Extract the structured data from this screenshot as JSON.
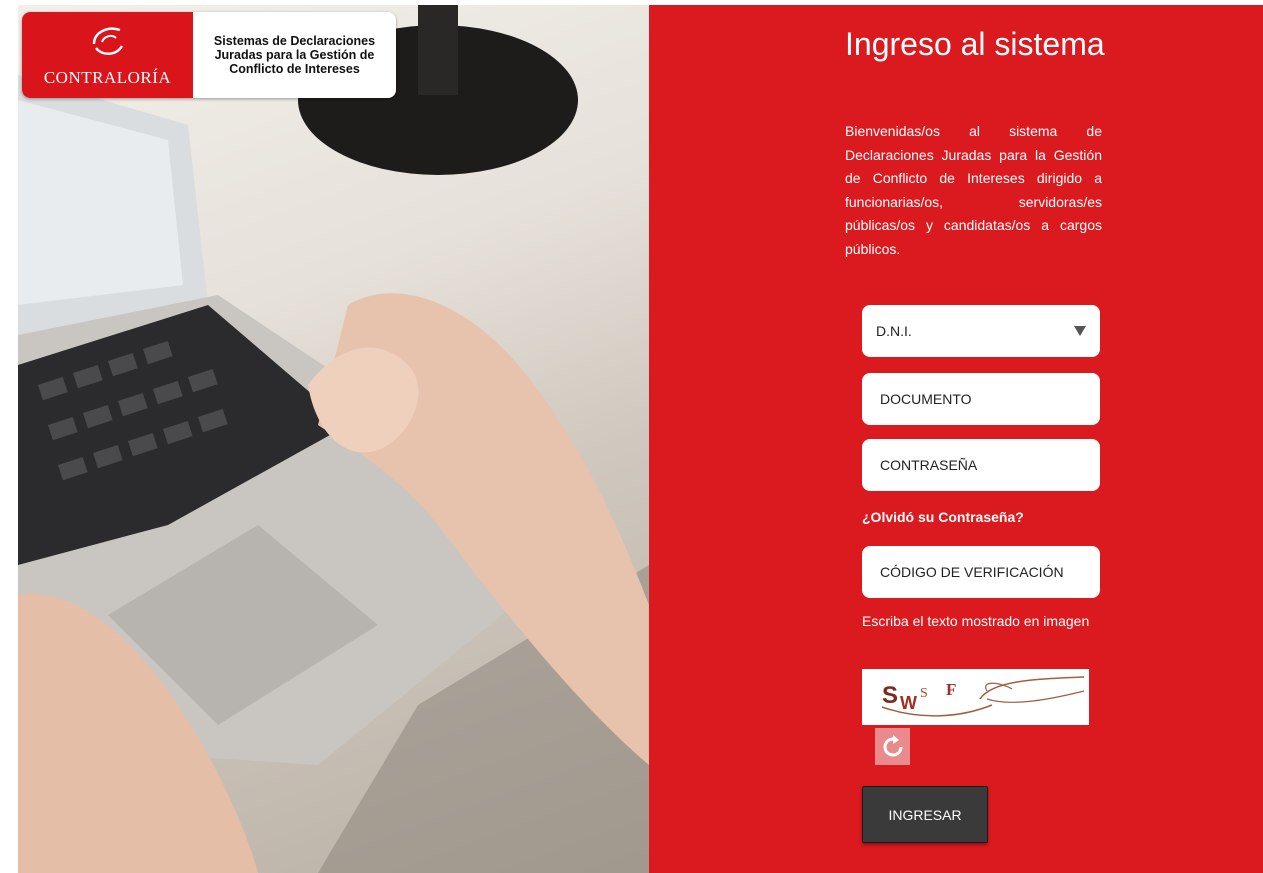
{
  "header": {
    "brand": "CONTRALORÍA",
    "system_name": "Sistemas de Declaraciones Juradas para la Gestión de Conflicto de Intereses"
  },
  "login": {
    "title": "Ingreso al sistema",
    "welcome_text": "Bienvenidas/os al sistema de Declaraciones Juradas para la Gestión de Conflicto de Intereses dirigido a funcionarias/os, servidoras/es públicas/os y candidatas/os a cargos públicos.",
    "doc_type_selected": "D.N.I.",
    "document_placeholder": "DOCUMENTO",
    "password_placeholder": "CONTRASEÑA",
    "forgot_password": "¿Olvidó su Contraseña?",
    "captcha_placeholder": "CÓDIGO DE VERIFICACIÓN",
    "captcha_hint": "Escriba el texto mostrado en imagen",
    "captcha_text": "SwS F",
    "submit_label": "INGRESAR"
  },
  "colors": {
    "panel_red": "#db1a1f",
    "button_dark": "#3a3a3a",
    "refresh_pink": "#e98a8c"
  },
  "icons": {
    "select_caret": "caret-down-icon",
    "refresh": "refresh-icon",
    "logo": "contraloria-logo"
  }
}
